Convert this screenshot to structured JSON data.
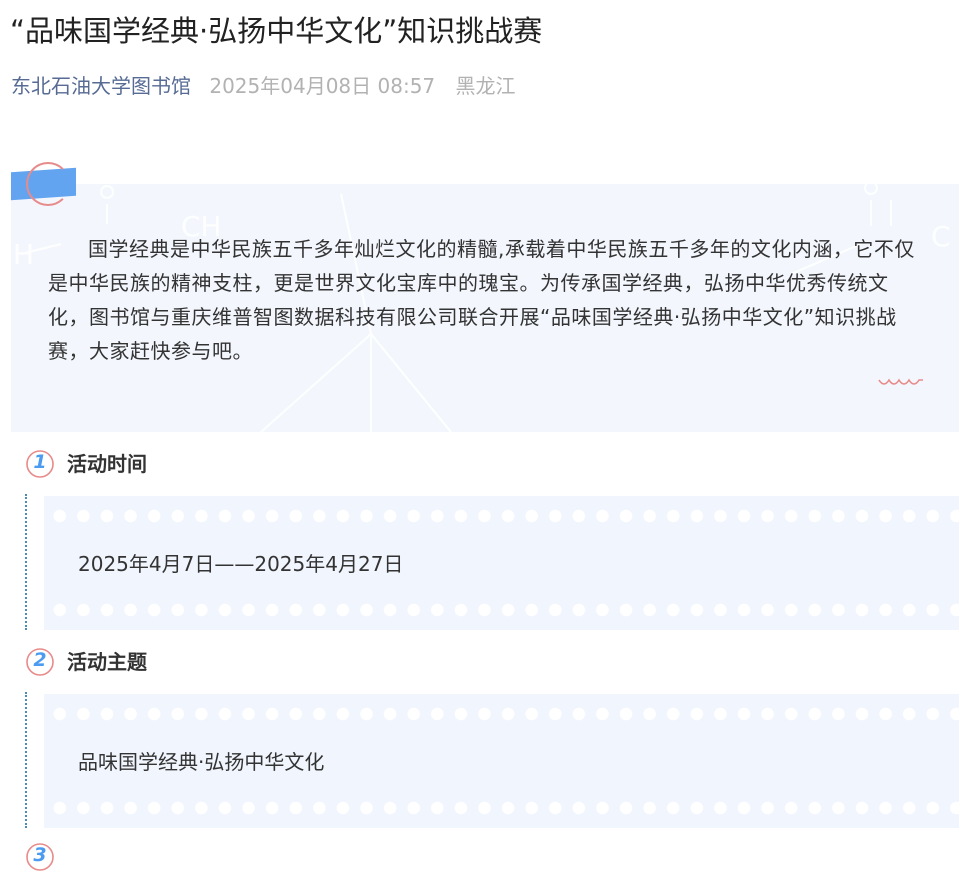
{
  "article": {
    "title": "“品味国学经典·弘扬中华文化”知识挑战赛",
    "source": "东北石油大学图书馆",
    "date": "2025年04月08日 08:57",
    "region": "黑龙江"
  },
  "intro": {
    "text": "国学经典是中华民族五千多年灿烂文化的精髓,承载着中华民族五千多年的文化内涵，它不仅是中华民族的精神支柱，更是世界文化宝库中的瑰宝。为传承国学经典，弘扬中华优秀传统文化，图书馆与重庆维普智图数据科技有限公司联合开展“品味国学经典·弘扬中华文化”知识挑战赛，大家赶快参与吧。"
  },
  "sections": [
    {
      "number": "1",
      "title": "活动时间",
      "value": "2025年4月7日——2025年4月27日"
    },
    {
      "number": "2",
      "title": "活动主题",
      "value": "品味国学经典·弘扬中华文化"
    },
    {
      "number": "3"
    }
  ],
  "colors": {
    "accent_blue": "#4b9bf0",
    "tape_blue": "#63a4f1",
    "ring_pink": "#e78b8b",
    "box_bg": "#f1f5fd",
    "source_link": "#576b95",
    "meta_gray": "#b2b2b2"
  }
}
